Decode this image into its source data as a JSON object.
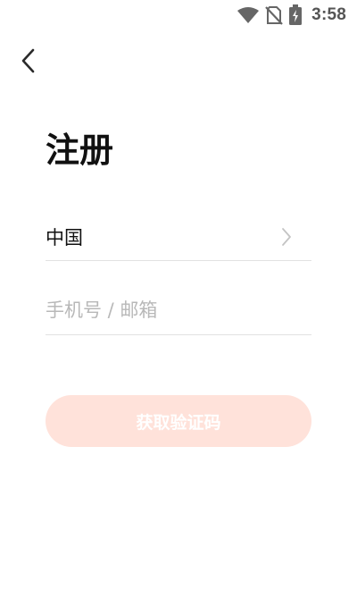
{
  "status_bar": {
    "time": "3:58",
    "icons": [
      "wifi-icon",
      "no-sim-icon",
      "battery-charging-icon"
    ]
  },
  "navigation": {
    "back_icon": "chevron-left-icon"
  },
  "page": {
    "title": "注册"
  },
  "country": {
    "label": "中国",
    "icon": "chevron-right-icon"
  },
  "account_input": {
    "value": "",
    "placeholder": "手机号 / 邮箱"
  },
  "submit": {
    "label": "获取验证码",
    "enabled": false
  },
  "colors": {
    "button_disabled_bg": "#ffe2da",
    "button_text": "#ffffff",
    "divider": "#e2e2e2",
    "placeholder": "#b8b8b8",
    "status_icons": "#666666"
  }
}
